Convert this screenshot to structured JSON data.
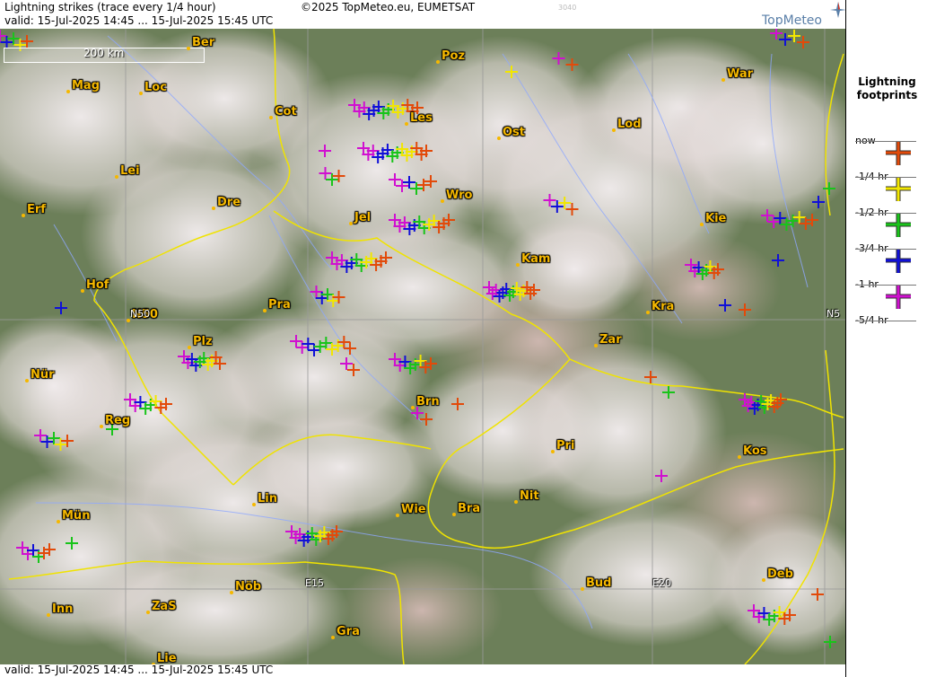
{
  "header": {
    "title": "Lightning strikes (trace every 1/4 hour)",
    "valid_top": "valid:  15-Jul-2025 14:45 ... 15-Jul-2025 15:45 UTC",
    "copyright": "©2025 TopMeteo.eu, EUMETSAT",
    "code": "3040",
    "brand": "TopMeteo"
  },
  "footer": {
    "valid_bottom": "valid:  15-Jul-2025 14:45 ... 15-Jul-2025 15:45 UTC"
  },
  "scale": {
    "label": "200 km"
  },
  "grid_labels": [
    "N50",
    "E15",
    "E20",
    "N5"
  ],
  "cities": [
    "Ber",
    "Poz",
    "War",
    "Mag",
    "Loc",
    "Cot",
    "Ost",
    "Lod",
    "Les",
    "Lei",
    "Wro",
    "Erf",
    "Dre",
    "Jel",
    "Kie",
    "Kam",
    "Hof",
    "Pra",
    "Kra",
    "N50",
    "Zar",
    "Plz",
    "Nür",
    "Brn",
    "Reg",
    "Kos",
    "Pri",
    "Lin",
    "Nit",
    "Wie",
    "Bra",
    "Mün",
    "Bud",
    "Deb",
    "Inn",
    "ZaS",
    "Nöb",
    "Gra",
    "Lie"
  ],
  "legend": {
    "title_line1": "Lightning",
    "title_line2": "footprints",
    "items": [
      {
        "label": "now",
        "color": "#e24a0a"
      },
      {
        "label": "-1/4 hr",
        "color": "#f2e600"
      },
      {
        "label": "-1/2 hr",
        "color": "#19c41a"
      },
      {
        "label": "-3/4 hr",
        "color": "#1010d8"
      },
      {
        "label": "-1 hr",
        "color": "#d010d0"
      },
      {
        "label": "-5/4 hr",
        "color": ""
      }
    ]
  },
  "colors": {
    "city_label": "#f5b800",
    "border": "#f0e300",
    "river": "#8ea8ff"
  }
}
